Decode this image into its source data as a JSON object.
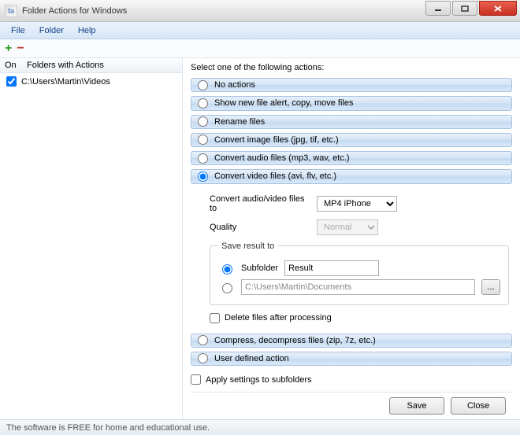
{
  "window": {
    "title": "Folder Actions for Windows",
    "appicon_text": "fa"
  },
  "menu": {
    "file": "File",
    "folder": "Folder",
    "help": "Help"
  },
  "toolbar": {
    "add": "+",
    "remove": "−"
  },
  "folders": {
    "header_on": "On",
    "header_name": "Folders with Actions",
    "items": [
      {
        "checked": true,
        "path": "C:\\Users\\Martin\\Videos"
      }
    ]
  },
  "actions": {
    "select_label": "Select one of the following actions:",
    "options": {
      "none": "No actions",
      "alert": "Show new file alert, copy, move files",
      "rename": "Rename files",
      "image": "Convert image files (jpg, tif, etc.)",
      "audio": "Convert audio files (mp3, wav, etc.)",
      "video": "Convert video files (avi, flv, etc.)",
      "compress": "Compress, decompress files (zip, 7z, etc.)",
      "user": "User defined action"
    },
    "selected": "video"
  },
  "convert": {
    "target_label": "Convert audio/video files to",
    "target_value": "MP4 iPhone",
    "quality_label": "Quality",
    "quality_value": "Normal",
    "save_legend": "Save result to",
    "subfolder_label": "Subfolder",
    "subfolder_value": "Result",
    "path_value": "C:\\Users\\Martin\\Documents",
    "browse_label": "...",
    "delete_label": "Delete files after processing"
  },
  "apply_subfolders_label": "Apply settings to subfolders",
  "buttons": {
    "save": "Save",
    "close": "Close"
  },
  "status": "The software is FREE for home and educational use."
}
